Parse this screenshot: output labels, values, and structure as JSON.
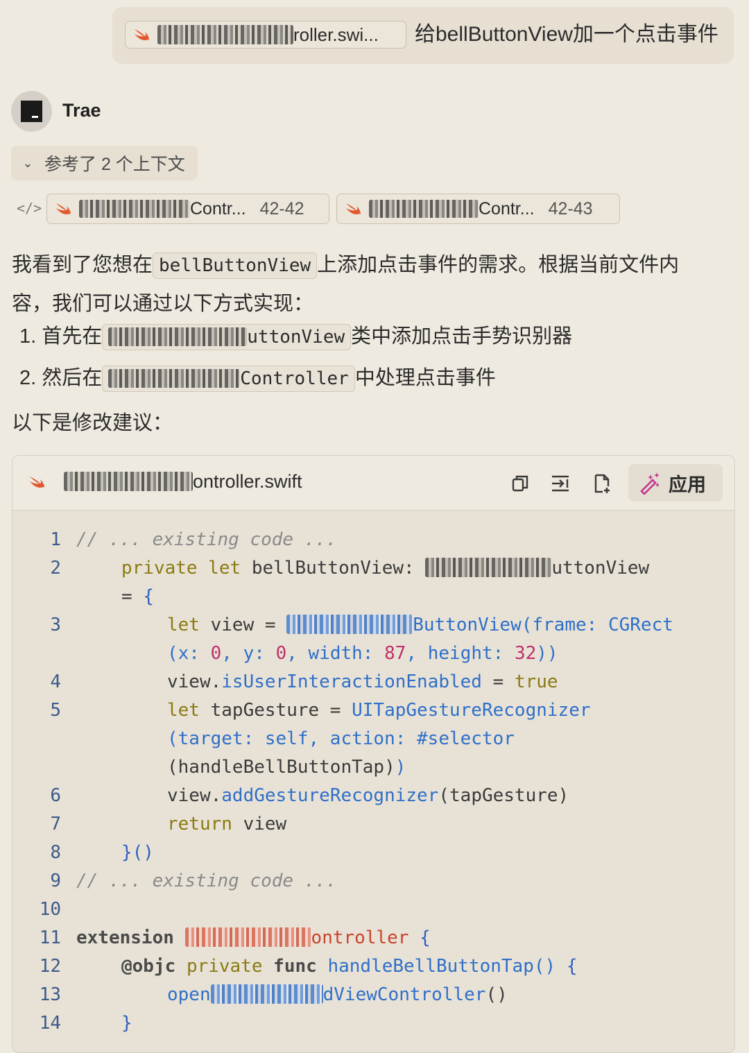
{
  "user_message": {
    "file_chip": "roller.swi...",
    "text": "给bellButtonView加一个点击事件"
  },
  "assistant": {
    "name": "Trae",
    "context_toggle": "参考了 2 个上下文",
    "refs": [
      {
        "name": "Contr...",
        "range": "42-42"
      },
      {
        "name": "Contr...",
        "range": "42-43"
      }
    ],
    "para1_a": "我看到了您想在",
    "para1_code": "bellButtonView",
    "para1_b": "上添加点击事件的需求。根据当前文件内",
    "para2": "容，我们可以通过以下方式实现：",
    "item1_num": "1.",
    "item1_a": "首先在",
    "item1_code": "uttonView",
    "item1_b": "类中添加点击手势识别器",
    "item2_num": "2.",
    "item2_a": "然后在",
    "item2_code": "Controller",
    "item2_b": "中处理点击事件",
    "para3": "以下是修改建议："
  },
  "code_card": {
    "file_name": "ontroller.swift",
    "apply_label": "应用",
    "tools": [
      "copy-icon",
      "insert-icon",
      "new-file-icon"
    ],
    "lines": [
      "1",
      "2",
      "3",
      "4",
      "5",
      "6",
      "7",
      "8",
      "9",
      "10",
      "11",
      "12",
      "13",
      "14"
    ]
  }
}
